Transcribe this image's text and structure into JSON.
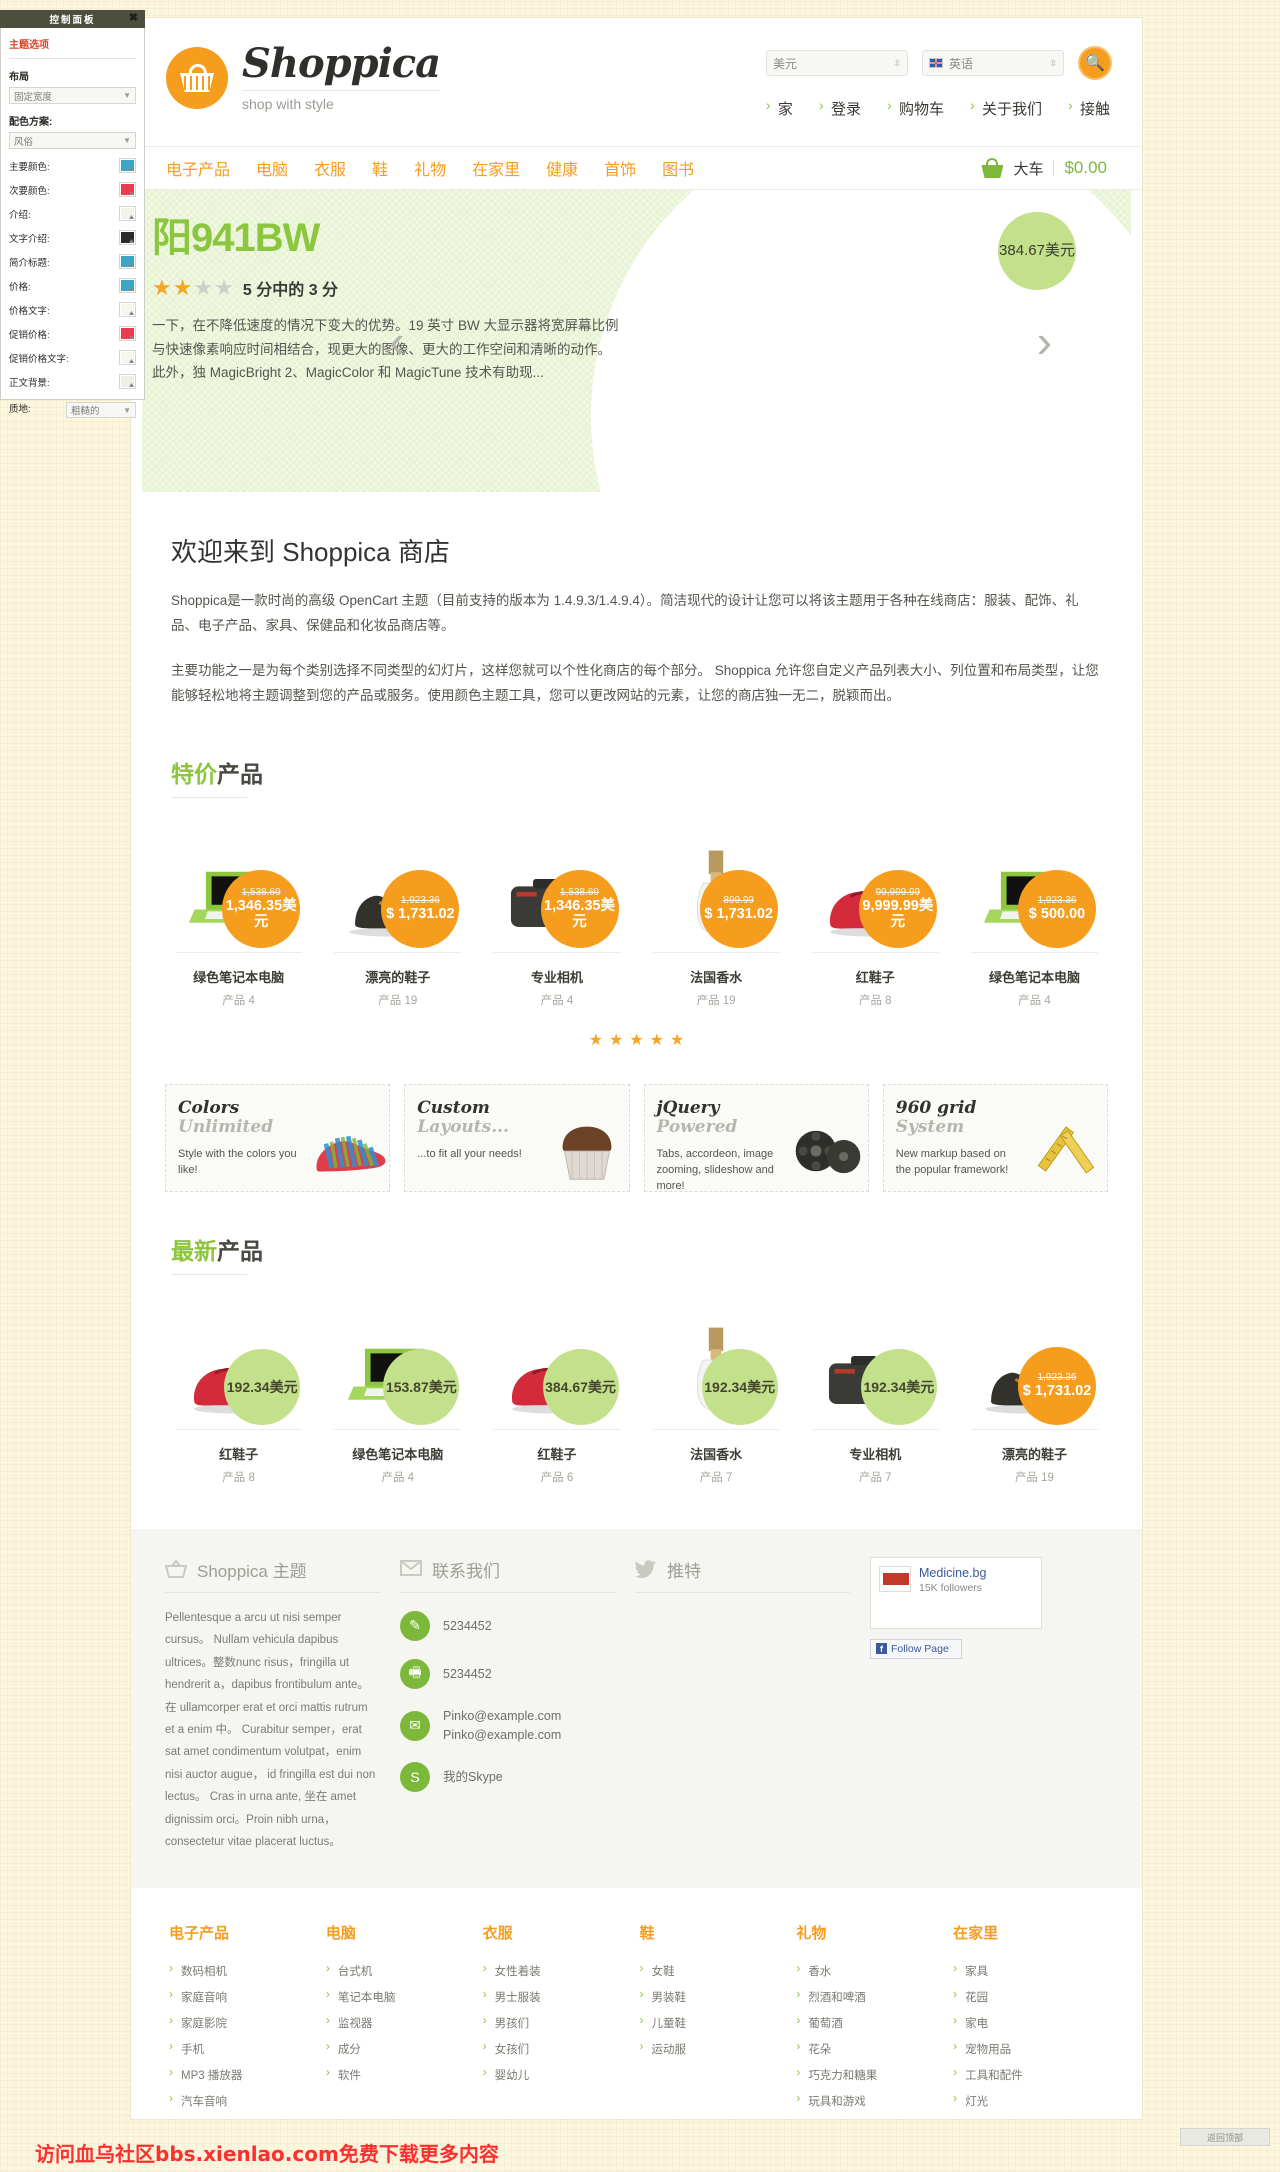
{
  "control_panel": {
    "title": "控制面板",
    "close_icon": "close-icon",
    "tab": "主题选项",
    "layout_label": "布局",
    "layout_value": "固定宽度",
    "scheme_label": "配色方案:",
    "scheme_value": "风俗",
    "colors": [
      {
        "label": "主要颜色:",
        "hex": "#3aa6c4"
      },
      {
        "label": "次要颜色:",
        "hex": "#ee3a4e"
      },
      {
        "label": "介绍:",
        "hex": "#f3f3ee"
      },
      {
        "label": "文字介绍:",
        "hex": "#2a2a26"
      },
      {
        "label": "简介标题:",
        "hex": "#3aa6c4"
      },
      {
        "label": "价格:",
        "hex": "#3aa6c4"
      },
      {
        "label": "价格文字:",
        "hex": "#f6f6f1"
      },
      {
        "label": "促销价格:",
        "hex": "#ee3a4e"
      },
      {
        "label": "促销价格文字:",
        "hex": "#f6f6f1"
      },
      {
        "label": "正文背景:",
        "hex": "#efefe7"
      }
    ],
    "texture_label": "质地:",
    "texture_value": "粗糙的"
  },
  "header": {
    "brand": "Shoppica",
    "tagline": "shop with style",
    "currency": "美元",
    "language": "英语",
    "search_icon": "search-icon",
    "top_nav": [
      "家",
      "登录",
      "购物车",
      "关于我们",
      "接触"
    ]
  },
  "mainnav": {
    "categories": [
      "电子产品",
      "电脑",
      "衣服",
      "鞋",
      "礼物",
      "在家里",
      "健康",
      "首饰",
      "图书"
    ],
    "cart_label": "大车",
    "cart_total": "$0.00"
  },
  "slider": {
    "title": "阳941BW",
    "rating_stars": "3",
    "rating_text": "5 分中的 3 分",
    "description": "一下，在不降低速度的情况下变大的优势。19 英寸 BW 大显示器将宽屏幕比例与快速像素响应时间相结合，现更大的图像、更大的工作空间和清晰的动作。此外，独 MagicBright 2、MagicColor 和 MagicTune 技术有助现...",
    "price": "384.67美元",
    "prev_icon": "chevron-left-icon",
    "next_icon": "chevron-right-icon"
  },
  "welcome": {
    "heading": "欢迎来到 Shoppica 商店",
    "p1": "Shoppica是一款时尚的高级 OpenCart 主题（目前支持的版本为 1.4.9.3/1.4.9.4）。简洁现代的设计让您可以将该主题用于各种在线商店：服装、配饰、礼品、电子产品、家具、保健品和化妆品商店等。",
    "p2": "主要功能之一是为每个类别选择不同类型的幻灯片，这样您就可以个性化商店的每个部分。 Shoppica 允许您自定义产品列表大小、列位置和布局类型，让您能够轻松地将主题调整到您的产品或服务。使用颜色主题工具，您可以更改网站的元素，让您的商店独一无二，脱颖而出。"
  },
  "specials": {
    "heading_green": "特价",
    "heading_dark": "产品",
    "products": [
      {
        "name": "绿色笔记本电脑",
        "model": "产品 4",
        "old": "1,538.69",
        "new": "1,346.35美元",
        "art": "laptop-green"
      },
      {
        "name": "漂亮的鞋子",
        "model": "产品 19",
        "old": "1,923.36",
        "new": "$ 1,731.02",
        "art": "dress-shoes"
      },
      {
        "name": "专业相机",
        "model": "产品 4",
        "old": "1,538.69",
        "new": "1,346.35美元",
        "art": "camera"
      },
      {
        "name": "法国香水",
        "model": "产品 19",
        "old": "899.99",
        "new": "$ 1,731.02",
        "art": "perfume"
      },
      {
        "name": "红鞋子",
        "model": "产品 8",
        "old": "99,999.99",
        "new": "9,999.99美元",
        "art": "red-shoes"
      },
      {
        "name": "绿色笔记本电脑",
        "model": "产品 4",
        "old": "1,923.36",
        "new": "$ 500.00",
        "art": "laptop-green"
      }
    ]
  },
  "features": [
    {
      "t1": "Colors",
      "t2": "Unlimited",
      "sub": "Style with the colors you like!",
      "art": "striped-shoe"
    },
    {
      "t1": "Custom",
      "t2": "Layouts...",
      "sub": "...to fit all your needs!",
      "art": "muffin"
    },
    {
      "t1": "jQuery",
      "t2": "Powered",
      "sub": "Tabs, accordeon, image zooming, slideshow and more!",
      "art": "film-reels"
    },
    {
      "t1": "960 grid",
      "t2": "System",
      "sub": "New markup based on the popular framework!",
      "art": "ruler"
    }
  ],
  "latest": {
    "heading_green": "最新",
    "heading_dark": "产品",
    "products": [
      {
        "name": "红鞋子",
        "model": "产品 8",
        "new": "192.34美元",
        "art": "red-shoes"
      },
      {
        "name": "绿色笔记本电脑",
        "model": "产品 4",
        "new": "153.87美元",
        "art": "laptop-green"
      },
      {
        "name": "红鞋子",
        "model": "产品 6",
        "new": "384.67美元",
        "art": "red-shoes"
      },
      {
        "name": "法国香水",
        "model": "产品 7",
        "new": "192.34美元",
        "art": "perfume"
      },
      {
        "name": "专业相机",
        "model": "产品 7",
        "new": "192.34美元",
        "art": "camera"
      },
      {
        "name": "漂亮的鞋子",
        "model": "产品 19",
        "old": "1,923.36",
        "new": "$ 1,731.02",
        "art": "dress-shoes"
      }
    ]
  },
  "footer": {
    "about": {
      "icon": "basket-icon",
      "title": "Shoppica 主题",
      "text": "Pellentesque a arcu ut nisi semper cursus。 Nullam vehicula dapibus ultrices。整数nunc risus，fringilla ut hendrerit a，dapibus frontibulum ante。在 ullamcorper erat et orci mattis rutrum et a enim 中。 Curabitur semper，erat sat amet condimentum volutpat，enim nisi auctor augue， id fringilla est dui non lectus。 Cras in urna ante, 坐在 amet dignissim orci。Proin nibh urna，consectetur vitae placerat luctus。"
    },
    "contact": {
      "icon": "envelope-icon",
      "title": "联系我们",
      "items": [
        {
          "icon": "pencil-icon",
          "value": "5234452"
        },
        {
          "icon": "fax-icon",
          "value": "5234452"
        },
        {
          "icon": "mail-icon",
          "value": "Pinko@example.com\nPinko@example.com"
        },
        {
          "icon": "skype-icon",
          "value": "我的Skype"
        }
      ]
    },
    "twitter": {
      "icon": "twitter-icon",
      "title": "推特"
    },
    "facebook": {
      "page": "Medicine.bg",
      "followers": "15K followers",
      "button": "Follow Page"
    }
  },
  "cat_footer": [
    {
      "title": "电子产品",
      "links": [
        "数码相机",
        "家庭音响",
        "家庭影院",
        "手机",
        "MP3 播放器",
        "汽车音响"
      ]
    },
    {
      "title": "电脑",
      "links": [
        "台式机",
        "笔记本电脑",
        "监视器",
        "成分",
        "软件"
      ]
    },
    {
      "title": "衣服",
      "links": [
        "女性着装",
        "男士服装",
        "男孩们",
        "女孩们",
        "婴幼儿"
      ]
    },
    {
      "title": "鞋",
      "links": [
        "女鞋",
        "男装鞋",
        "儿童鞋",
        "运动服"
      ]
    },
    {
      "title": "礼物",
      "links": [
        "香水",
        "烈酒和啤酒",
        "葡萄酒",
        "花朵",
        "巧克力和糖果",
        "玩具和游戏"
      ]
    },
    {
      "title": "在家里",
      "links": [
        "家具",
        "花园",
        "家电",
        "宠物用品",
        "工具和配件",
        "灯光"
      ]
    }
  ],
  "watermark": "访问血乌社区bbs.xienlao.com免费下载更多内容",
  "corner_button": "返回顶部"
}
